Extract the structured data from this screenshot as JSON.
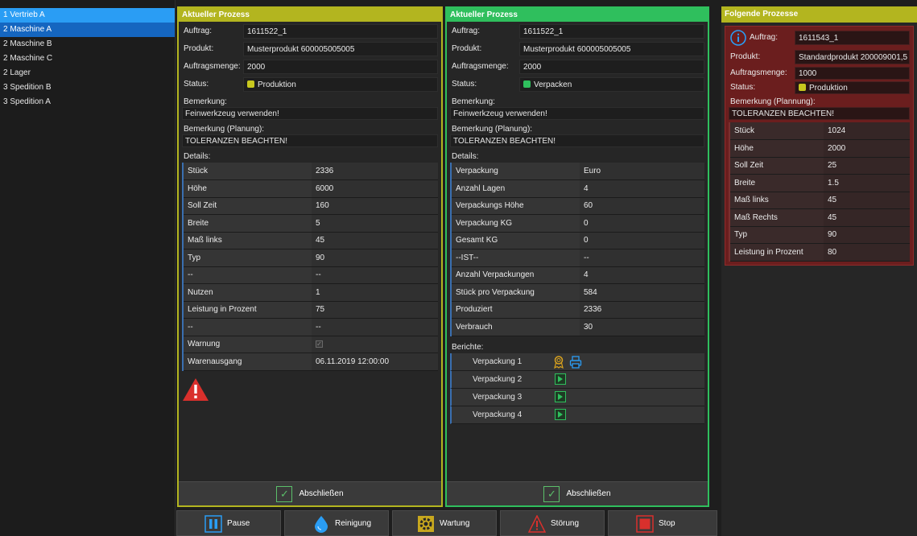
{
  "sidebar": {
    "items": [
      {
        "label": "1 Vertrieb A"
      },
      {
        "label": "2 Maschine A"
      },
      {
        "label": "2 Maschine B"
      },
      {
        "label": "2 Maschine C"
      },
      {
        "label": "2 Lager"
      },
      {
        "label": "3 Spedition B"
      },
      {
        "label": "3 Spedition A"
      }
    ]
  },
  "panel1": {
    "title": "Aktueller Prozess",
    "auftrag_label": "Auftrag:",
    "auftrag": "1611522_1",
    "produkt_label": "Produkt:",
    "produkt": "Musterprodukt 600005005005",
    "menge_label": "Auftragsmenge:",
    "menge": "2000",
    "status_label": "Status:",
    "status": "Produktion",
    "status_color": "#c8c81e",
    "bemerkung_label": "Bemerkung:",
    "bemerkung": "Feinwerkzeug verwenden!",
    "bemerkung_planung_label": "Bemerkung (Planung):",
    "bemerkung_planung": "TOLERANZEN BEACHTEN!",
    "details_label": "Details:",
    "details": [
      {
        "k": "Stück",
        "v": "2336"
      },
      {
        "k": "Höhe",
        "v": "6000"
      },
      {
        "k": "Soll Zeit",
        "v": "160"
      },
      {
        "k": "Breite",
        "v": "5"
      },
      {
        "k": "Maß links",
        "v": "45"
      },
      {
        "k": "Typ",
        "v": "90"
      },
      {
        "k": "--",
        "v": "--"
      },
      {
        "k": "Nutzen",
        "v": "1"
      },
      {
        "k": "Leistung in Prozent",
        "v": "75"
      },
      {
        "k": "--",
        "v": "--"
      },
      {
        "k": "Warnung",
        "v": ""
      },
      {
        "k": "Warenausgang",
        "v": "06.11.2019 12:00:00"
      }
    ],
    "complete_label": "Abschließen"
  },
  "panel2": {
    "title": "Aktueller Prozess",
    "auftrag_label": "Auftrag:",
    "auftrag": "1611522_1",
    "produkt_label": "Produkt:",
    "produkt": "Musterprodukt 600005005005",
    "menge_label": "Auftragsmenge:",
    "menge": "2000",
    "status_label": "Status:",
    "status": "Verpacken",
    "status_color": "#2fbf5d",
    "bemerkung_label": "Bemerkung:",
    "bemerkung": "Feinwerkzeug verwenden!",
    "bemerkung_planung_label": "Bemerkung (Planung):",
    "bemerkung_planung": "TOLERANZEN BEACHTEN!",
    "details_label": "Details:",
    "details": [
      {
        "k": "Verpackung",
        "v": "Euro"
      },
      {
        "k": "Anzahl Lagen",
        "v": "4"
      },
      {
        "k": "Verpackungs Höhe",
        "v": "60"
      },
      {
        "k": "Verpackung KG",
        "v": "0"
      },
      {
        "k": "Gesamt KG",
        "v": "0"
      },
      {
        "k": "--IST--",
        "v": "--"
      },
      {
        "k": "Anzahl Verpackungen",
        "v": "4"
      },
      {
        "k": "Stück pro Verpackung",
        "v": "584"
      },
      {
        "k": "Produziert",
        "v": "2336"
      },
      {
        "k": "Verbrauch",
        "v": "30"
      }
    ],
    "berichte_label": "Berichte:",
    "reports": [
      {
        "name": "Verpackung 1"
      },
      {
        "name": "Verpackung 2"
      },
      {
        "name": "Verpackung 3"
      },
      {
        "name": "Verpackung 4"
      }
    ],
    "complete_label": "Abschließen"
  },
  "panel3": {
    "title": "Folgende Prozesse",
    "auftrag_label": "Auftrag:",
    "auftrag": "1611543_1",
    "produkt_label": "Produkt:",
    "produkt": "Standardprodukt 200009001,5",
    "menge_label": "Auftragsmenge:",
    "menge": "1000",
    "status_label": "Status:",
    "status": "Produktion",
    "status_color": "#c8c81e",
    "bemerkung_planung_label": "Bemerkung (Plannung):",
    "bemerkung_planung": "TOLERANZEN BEACHTEN!",
    "details": [
      {
        "k": "Stück",
        "v": "1024"
      },
      {
        "k": "Höhe",
        "v": "2000"
      },
      {
        "k": "Soll Zeit",
        "v": "25"
      },
      {
        "k": "Breite",
        "v": "1.5"
      },
      {
        "k": "Maß links",
        "v": "45"
      },
      {
        "k": "Maß Rechts",
        "v": "45"
      },
      {
        "k": "Typ",
        "v": "90"
      },
      {
        "k": "Leistung in Prozent",
        "v": "80"
      }
    ]
  },
  "toolbar": {
    "pause": "Pause",
    "reinigung": "Reinigung",
    "wartung": "Wartung",
    "stoerung": "Störung",
    "stop": "Stop"
  },
  "colors": {
    "yellow_accent": "#b3b51f",
    "green_accent": "#2fbf5d",
    "selection_blue": "#1566c0",
    "warning_red": "#d9302c",
    "next_card_red": "#6b1e1e"
  }
}
